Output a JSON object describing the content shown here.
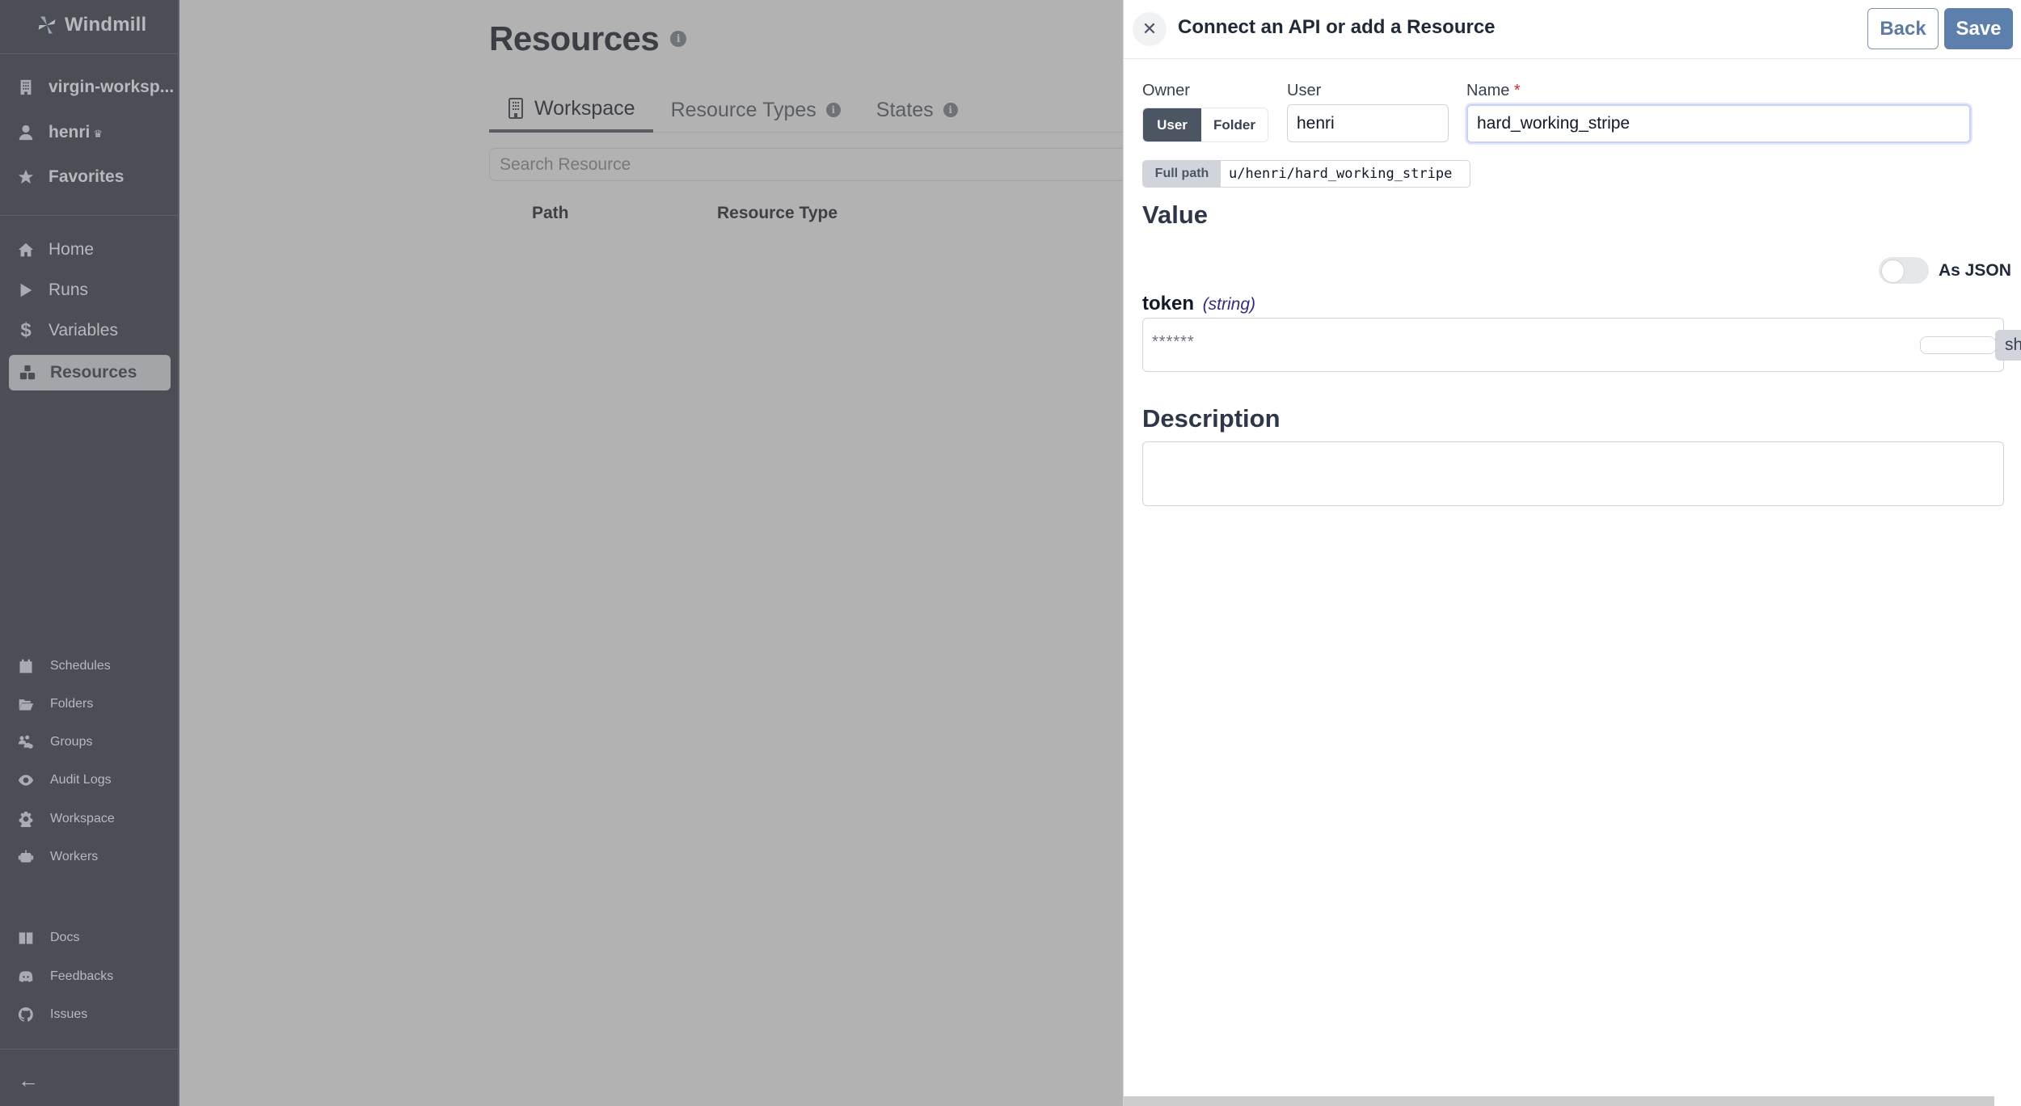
{
  "app": {
    "name": "Windmill"
  },
  "sidebar": {
    "workspace": "virgin-worksp...",
    "user": "henri",
    "favorites": "Favorites",
    "main_items": [
      {
        "label": "Home",
        "icon": "home-icon"
      },
      {
        "label": "Runs",
        "icon": "play-icon"
      },
      {
        "label": "Variables",
        "icon": "dollar-icon"
      },
      {
        "label": "Resources",
        "icon": "boxes-icon",
        "active": true
      }
    ],
    "secondary_items": [
      {
        "label": "Schedules",
        "icon": "calendar-icon"
      },
      {
        "label": "Folders",
        "icon": "folder-open-icon"
      },
      {
        "label": "Groups",
        "icon": "users-cog-icon"
      },
      {
        "label": "Audit Logs",
        "icon": "eye-icon"
      },
      {
        "label": "Workspace",
        "icon": "gear-icon"
      },
      {
        "label": "Workers",
        "icon": "robot-icon"
      }
    ],
    "help_items": [
      {
        "label": "Docs",
        "icon": "book-icon"
      },
      {
        "label": "Feedbacks",
        "icon": "discord-icon"
      },
      {
        "label": "Issues",
        "icon": "github-icon"
      }
    ],
    "collapse_icon": "arrow-left-icon"
  },
  "main": {
    "title": "Resources",
    "tabs": [
      {
        "label": "Workspace",
        "selected": true
      },
      {
        "label": "Resource Types"
      },
      {
        "label": "States"
      }
    ],
    "search_placeholder": "Search Resource",
    "columns": [
      "Path",
      "Resource Type"
    ]
  },
  "drawer": {
    "title": "Connect an API or add a Resource",
    "back_label": "Back",
    "save_label": "Save",
    "owner_label": "Owner",
    "owner_options": [
      "User",
      "Folder"
    ],
    "owner_selected": "User",
    "user_label": "User",
    "user_value": "henri",
    "name_label": "Name",
    "name_required": "*",
    "name_value": "hard_working_stripe",
    "full_path_label": "Full path",
    "full_path_value": "u/henri/hard_working_stripe",
    "value_heading": "Value",
    "as_json_label": "As JSON",
    "as_json_enabled": false,
    "field": {
      "name": "token",
      "type": "(string)",
      "masked_value": "******",
      "show_label": "sh"
    },
    "description_heading": "Description",
    "description_value": ""
  },
  "colors": {
    "sidebar_bg": "#4b4e55",
    "overlay_bg": "#b2b2b2",
    "save_button": "#5d7fab",
    "owner_selected_bg": "#4b5563"
  }
}
